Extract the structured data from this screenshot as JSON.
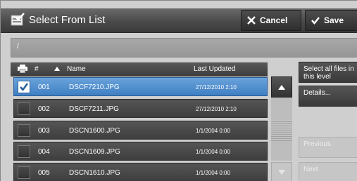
{
  "title": "Select From List",
  "toolbar": {
    "cancel_label": "Cancel",
    "save_label": "Save"
  },
  "path": "/",
  "list": {
    "headers": {
      "number": "#",
      "name": "Name",
      "last_updated": "Last Updated"
    },
    "rows": [
      {
        "number": "001",
        "name": "DSCF7210.JPG",
        "date": "27/12/2010 2:10",
        "selected": true
      },
      {
        "number": "002",
        "name": "DSCF7211.JPG",
        "date": "27/12/2010 2:10",
        "selected": false
      },
      {
        "number": "003",
        "name": "DSCN1600.JPG",
        "date": "1/1/2004 0:00",
        "selected": false
      },
      {
        "number": "004",
        "name": "DSCN1609.JPG",
        "date": "1/1/2004 0:00",
        "selected": false
      },
      {
        "number": "005",
        "name": "DSCN1610.JPG",
        "date": "1/1/2004 0:00",
        "selected": false
      }
    ]
  },
  "side": {
    "select_all": "Select all files in this level",
    "details": "Details...",
    "previous": "Previous",
    "next": "Next"
  },
  "colors": {
    "selection": "#4f8fd0",
    "titlebar": "#4a4a4a",
    "row": "#474747"
  },
  "icons": {
    "title": "list-select-icon",
    "cancel": "x-icon",
    "save": "checkmark-icon",
    "print": "printer-icon",
    "sort": "sort-ascending-icon",
    "scroll_up": "arrow-up-icon",
    "scroll_down": "arrow-down-icon"
  }
}
